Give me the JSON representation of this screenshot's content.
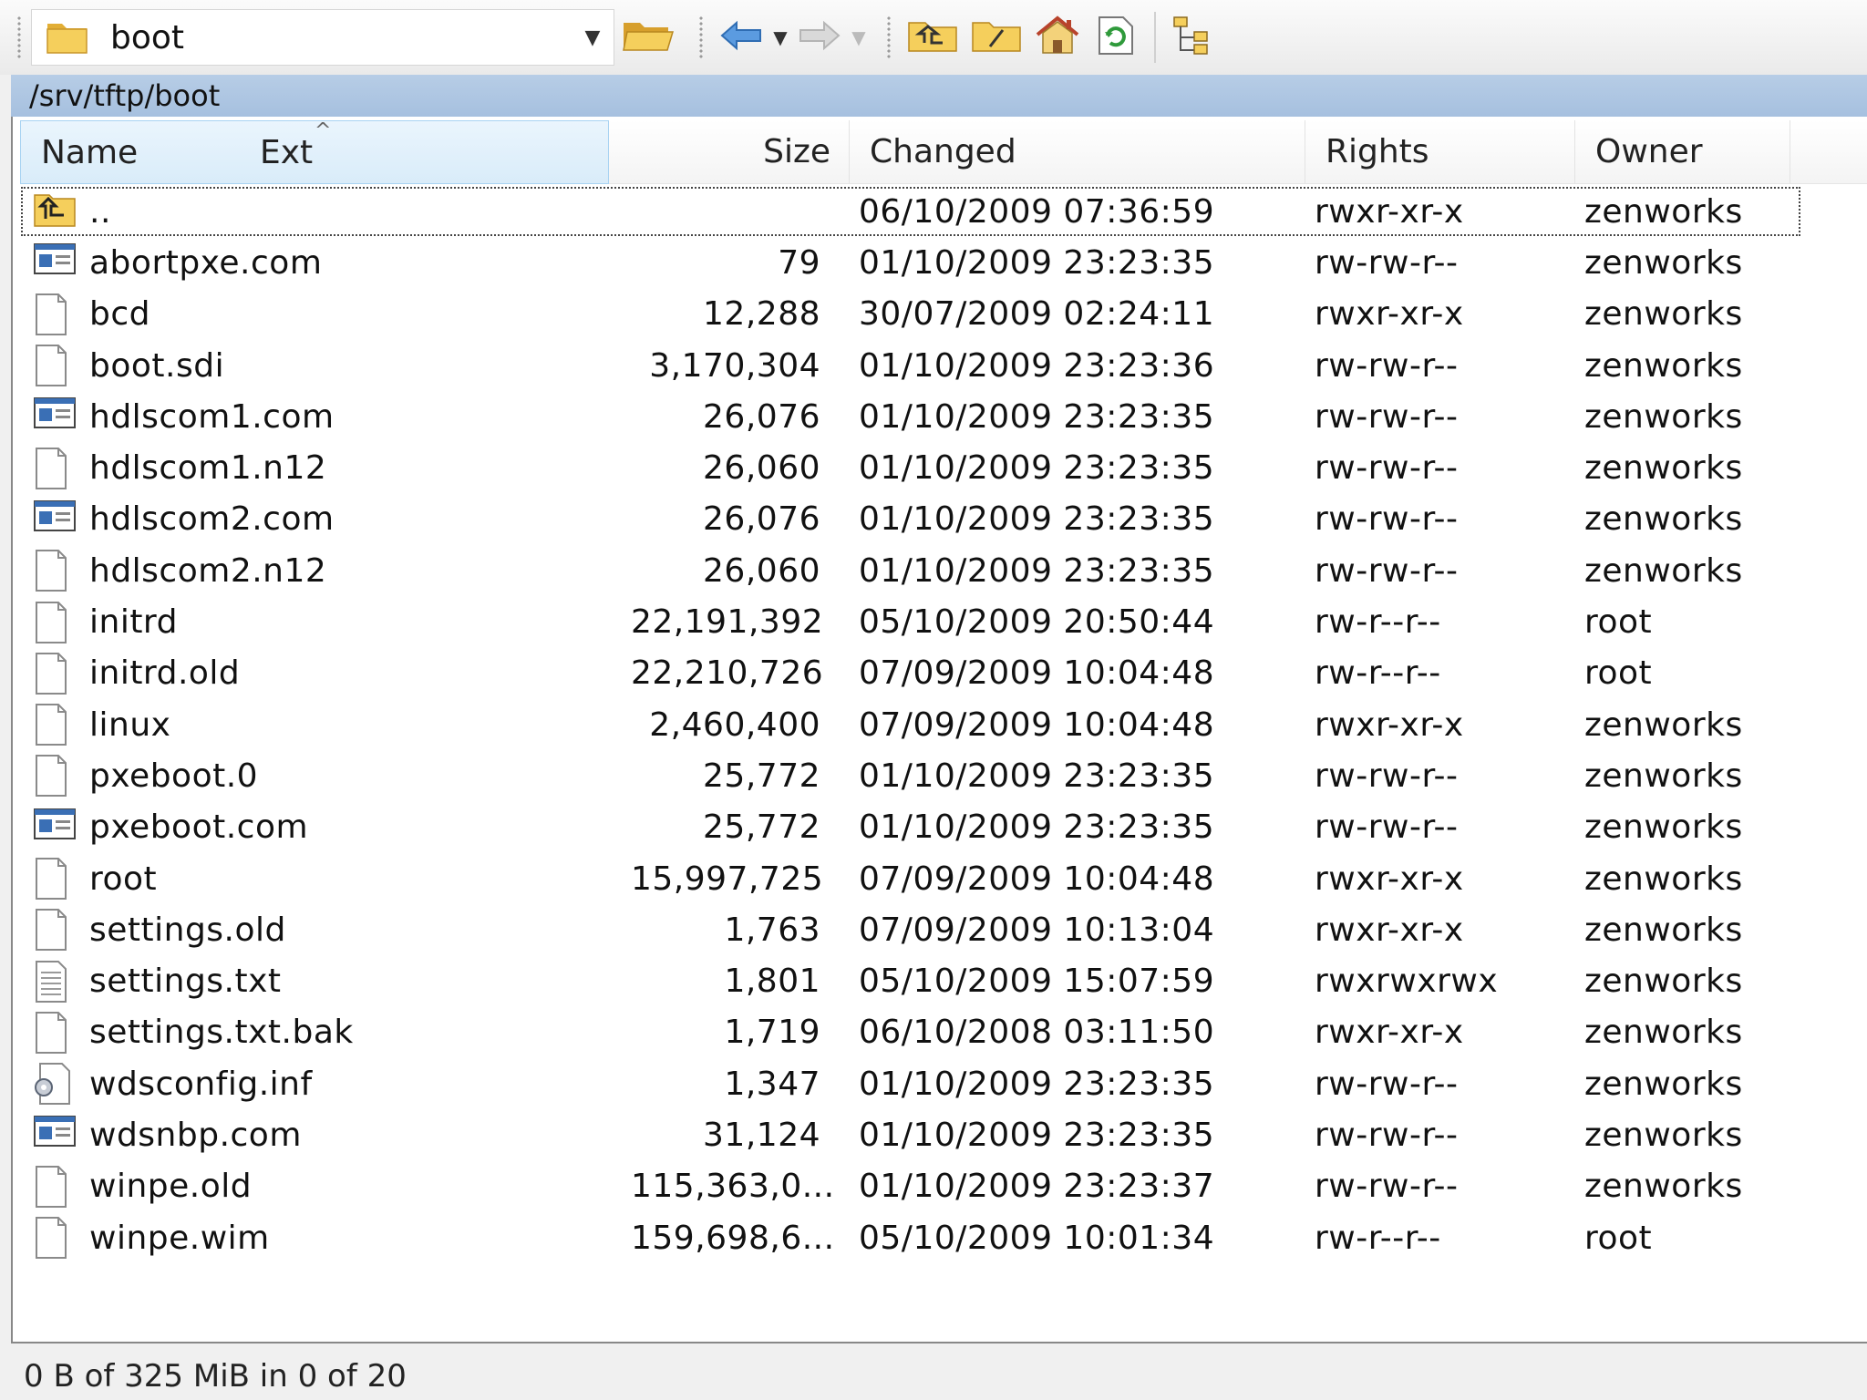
{
  "toolbar": {
    "path_combo_value": "boot",
    "icons": [
      "folder-icon",
      "open-folder-icon",
      "back-arrow-icon",
      "forward-arrow-icon",
      "parent-directory-icon",
      "root-directory-icon",
      "home-icon",
      "refresh-icon",
      "tree-view-icon"
    ]
  },
  "path_bar": {
    "text": "/srv/tftp/boot"
  },
  "columns": {
    "name": "Name",
    "ext": "Ext",
    "size": "Size",
    "changed": "Changed",
    "rights": "Rights",
    "owner": "Owner"
  },
  "files": [
    {
      "name": "..",
      "size": "",
      "changed": "06/10/2009 07:36:59",
      "rights": "rwxr-xr-x",
      "owner": "zenworks",
      "icon": "parent-folder"
    },
    {
      "name": "abortpxe.com",
      "size": "79",
      "changed": "01/10/2009 23:23:35",
      "rights": "rw-rw-r--",
      "owner": "zenworks",
      "icon": "executable"
    },
    {
      "name": "bcd",
      "size": "12,288",
      "changed": "30/07/2009 02:24:11",
      "rights": "rwxr-xr-x",
      "owner": "zenworks",
      "icon": "file"
    },
    {
      "name": "boot.sdi",
      "size": "3,170,304",
      "changed": "01/10/2009 23:23:36",
      "rights": "rw-rw-r--",
      "owner": "zenworks",
      "icon": "file"
    },
    {
      "name": "hdlscom1.com",
      "size": "26,076",
      "changed": "01/10/2009 23:23:35",
      "rights": "rw-rw-r--",
      "owner": "zenworks",
      "icon": "executable"
    },
    {
      "name": "hdlscom1.n12",
      "size": "26,060",
      "changed": "01/10/2009 23:23:35",
      "rights": "rw-rw-r--",
      "owner": "zenworks",
      "icon": "file"
    },
    {
      "name": "hdlscom2.com",
      "size": "26,076",
      "changed": "01/10/2009 23:23:35",
      "rights": "rw-rw-r--",
      "owner": "zenworks",
      "icon": "executable"
    },
    {
      "name": "hdlscom2.n12",
      "size": "26,060",
      "changed": "01/10/2009 23:23:35",
      "rights": "rw-rw-r--",
      "owner": "zenworks",
      "icon": "file"
    },
    {
      "name": "initrd",
      "size": "22,191,392",
      "changed": "05/10/2009 20:50:44",
      "rights": "rw-r--r--",
      "owner": "root",
      "icon": "file"
    },
    {
      "name": "initrd.old",
      "size": "22,210,726",
      "changed": "07/09/2009 10:04:48",
      "rights": "rw-r--r--",
      "owner": "root",
      "icon": "file"
    },
    {
      "name": "linux",
      "size": "2,460,400",
      "changed": "07/09/2009 10:04:48",
      "rights": "rwxr-xr-x",
      "owner": "zenworks",
      "icon": "file"
    },
    {
      "name": "pxeboot.0",
      "size": "25,772",
      "changed": "01/10/2009 23:23:35",
      "rights": "rw-rw-r--",
      "owner": "zenworks",
      "icon": "file"
    },
    {
      "name": "pxeboot.com",
      "size": "25,772",
      "changed": "01/10/2009 23:23:35",
      "rights": "rw-rw-r--",
      "owner": "zenworks",
      "icon": "executable"
    },
    {
      "name": "root",
      "size": "15,997,725",
      "changed": "07/09/2009 10:04:48",
      "rights": "rwxr-xr-x",
      "owner": "zenworks",
      "icon": "file"
    },
    {
      "name": "settings.old",
      "size": "1,763",
      "changed": "07/09/2009 10:13:04",
      "rights": "rwxr-xr-x",
      "owner": "zenworks",
      "icon": "file"
    },
    {
      "name": "settings.txt",
      "size": "1,801",
      "changed": "05/10/2009 15:07:59",
      "rights": "rwxrwxrwx",
      "owner": "zenworks",
      "icon": "text"
    },
    {
      "name": "settings.txt.bak",
      "size": "1,719",
      "changed": "06/10/2008 03:11:50",
      "rights": "rwxr-xr-x",
      "owner": "zenworks",
      "icon": "file"
    },
    {
      "name": "wdsconfig.inf",
      "size": "1,347",
      "changed": "01/10/2009 23:23:35",
      "rights": "rw-rw-r--",
      "owner": "zenworks",
      "icon": "config"
    },
    {
      "name": "wdsnbp.com",
      "size": "31,124",
      "changed": "01/10/2009 23:23:35",
      "rights": "rw-rw-r--",
      "owner": "zenworks",
      "icon": "executable"
    },
    {
      "name": "winpe.old",
      "size": "115,363,0...",
      "changed": "01/10/2009 23:23:37",
      "rights": "rw-rw-r--",
      "owner": "zenworks",
      "icon": "file"
    },
    {
      "name": "winpe.wim",
      "size": "159,698,6...",
      "changed": "05/10/2009 10:01:34",
      "rights": "rw-r--r--",
      "owner": "root",
      "icon": "file"
    }
  ],
  "status": {
    "text": "0 B of 325 MiB in 0 of 20"
  },
  "colors": {
    "path_bar": "#a9c3e1",
    "sorted_header": "#dcedf9",
    "folder": "#f2c94c"
  }
}
